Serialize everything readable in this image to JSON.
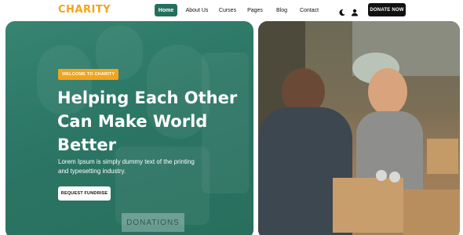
{
  "brand": {
    "logo": "CHARITY",
    "accent": "#f4a31b",
    "primary": "#23705f"
  },
  "nav": {
    "items": [
      {
        "label": "Home",
        "active": true
      },
      {
        "label": "About Us",
        "active": false
      },
      {
        "label": "Curses",
        "active": false
      },
      {
        "label": "Pages",
        "active": false
      },
      {
        "label": "Blog",
        "active": false
      },
      {
        "label": "Contact",
        "active": false
      }
    ],
    "icons": [
      "moon-icon",
      "user-icon"
    ],
    "donate_label": "DONATE NOW"
  },
  "hero": {
    "badge": "WELCOME TO CHARITY",
    "headline": "Helping Each Other Can Make World Better",
    "subtext": "Lorem Ipsum is simply dummy text of the printing and typesetting industry.",
    "cta_label": "REQUEST FUNDRISE",
    "box_label": "DONATIONS"
  }
}
